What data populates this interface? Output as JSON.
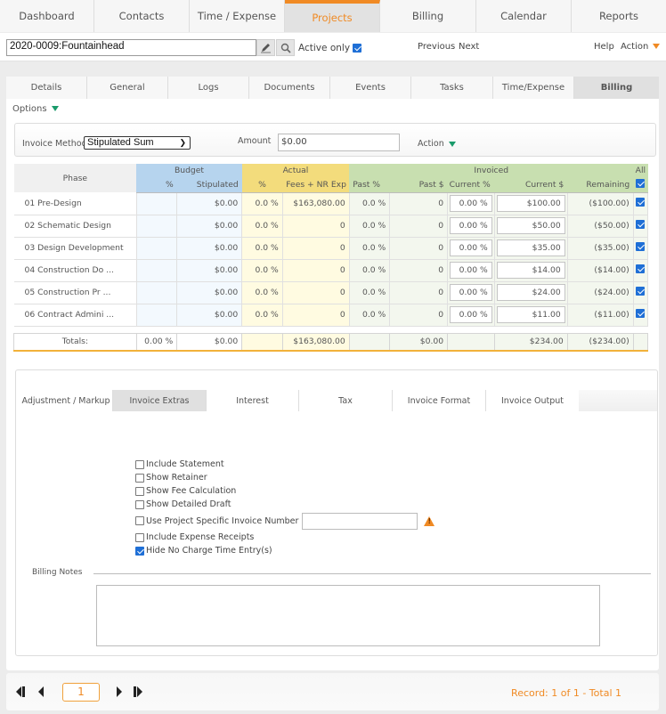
{
  "nav": {
    "tabs": [
      {
        "label": "Dashboard",
        "active": false
      },
      {
        "label": "Contacts",
        "active": false
      },
      {
        "label": "Time / Expense",
        "active": false
      },
      {
        "label": "Projects",
        "active": true
      },
      {
        "label": "Billing",
        "active": false
      },
      {
        "label": "Calendar",
        "active": false
      },
      {
        "label": "Reports",
        "active": false
      }
    ]
  },
  "search": {
    "project_value": "2020-0009:Fountainhead",
    "active_only_label": "Active only",
    "active_only_checked": true,
    "previous_label": "Previous",
    "next_label": "Next",
    "help_label": "Help",
    "action_label": "Action"
  },
  "subtabs": [
    {
      "label": "Details"
    },
    {
      "label": "General"
    },
    {
      "label": "Logs"
    },
    {
      "label": "Documents"
    },
    {
      "label": "Events"
    },
    {
      "label": "Tasks"
    },
    {
      "label": "Time/Expense"
    },
    {
      "label": "Billing",
      "active": true
    }
  ],
  "options_label": "Options",
  "invoice": {
    "method_label": "Invoice Method",
    "method_value": "Stipulated Sum",
    "amount_label": "Amount",
    "amount_value": "$0.00",
    "action_label": "Action"
  },
  "grid": {
    "headers": {
      "phase": "Phase",
      "budget": "Budget",
      "actual": "Actual",
      "invoiced": "Invoiced",
      "all": "All",
      "budget_pct": "%",
      "budget_stip": "Stipulated",
      "actual_pct": "%",
      "actual_fees": "Fees + NR Exp",
      "past_pct": "Past %",
      "past_dollar": "Past $",
      "current_pct": "Current %",
      "current_dollar": "Current $",
      "remaining": "Remaining"
    },
    "all_checked": true,
    "rows": [
      {
        "phase": "01 Pre-Design",
        "budget_pct": "",
        "stipulated": "$0.00",
        "actual_pct": "0.0 %",
        "fees": "$163,080.00",
        "past_pct": "0.0 %",
        "past_dollar": "0",
        "current_pct": "0.00 %",
        "current_dollar": "$100.00",
        "remaining": "($100.00)",
        "checked": true
      },
      {
        "phase": "02 Schematic Design",
        "budget_pct": "",
        "stipulated": "$0.00",
        "actual_pct": "0.0 %",
        "fees": "0",
        "past_pct": "0.0 %",
        "past_dollar": "0",
        "current_pct": "0.00 %",
        "current_dollar": "$50.00",
        "remaining": "($50.00)",
        "checked": true
      },
      {
        "phase": "03 Design Development",
        "budget_pct": "",
        "stipulated": "$0.00",
        "actual_pct": "0.0 %",
        "fees": "0",
        "past_pct": "0.0 %",
        "past_dollar": "0",
        "current_pct": "0.00 %",
        "current_dollar": "$35.00",
        "remaining": "($35.00)",
        "checked": true
      },
      {
        "phase": "04 Construction Do ...",
        "budget_pct": "",
        "stipulated": "$0.00",
        "actual_pct": "0.0 %",
        "fees": "0",
        "past_pct": "0.0 %",
        "past_dollar": "0",
        "current_pct": "0.00 %",
        "current_dollar": "$14.00",
        "remaining": "($14.00)",
        "checked": true
      },
      {
        "phase": "05 Construction Pr ...",
        "budget_pct": "",
        "stipulated": "$0.00",
        "actual_pct": "0.0 %",
        "fees": "0",
        "past_pct": "0.0 %",
        "past_dollar": "0",
        "current_pct": "0.00 %",
        "current_dollar": "$24.00",
        "remaining": "($24.00)",
        "checked": true
      },
      {
        "phase": "06 Contract Admini ...",
        "budget_pct": "",
        "stipulated": "$0.00",
        "actual_pct": "0.0 %",
        "fees": "0",
        "past_pct": "0.0 %",
        "past_dollar": "0",
        "current_pct": "0.00 %",
        "current_dollar": "$11.00",
        "remaining": "($11.00)",
        "checked": true
      }
    ],
    "totals": {
      "label": "Totals:",
      "budget_pct": "0.00 %",
      "stipulated": "$0.00",
      "actual_pct": "",
      "fees": "$163,080.00",
      "past_pct": "",
      "past_dollar": "$0.00",
      "current_pct": "",
      "current_dollar": "$234.00",
      "remaining": "($234.00)"
    }
  },
  "lower_tabs": [
    {
      "label": "Adjustment / Markup"
    },
    {
      "label": "Invoice Extras",
      "active": true
    },
    {
      "label": "Interest"
    },
    {
      "label": "Tax"
    },
    {
      "label": "Invoice Format"
    },
    {
      "label": "Invoice Output"
    }
  ],
  "extras": [
    {
      "label": "Include Statement",
      "checked": false
    },
    {
      "label": "Show Retainer",
      "checked": false
    },
    {
      "label": "Show Fee Calculation",
      "checked": false
    },
    {
      "label": "Show Detailed Draft",
      "checked": false
    },
    {
      "label": "Use Project Specific Invoice Number",
      "checked": false,
      "has_input": true,
      "input_value": ""
    },
    {
      "label": "Include Expense Receipts",
      "checked": false
    },
    {
      "label": "Hide No Charge Time Entry(s)",
      "checked": true
    }
  ],
  "billing_notes": {
    "label": "Billing Notes",
    "value": ""
  },
  "pager": {
    "page": "1",
    "record_text": "Record: 1 of 1 - Total 1"
  },
  "colors": {
    "accent": "#f08a24",
    "budget": "#b6d4ee",
    "actual": "#f3dc7c",
    "invoiced": "#c8dfb0",
    "checkbox": "#1f6fd6",
    "options_arrow": "#1a9b6b"
  }
}
